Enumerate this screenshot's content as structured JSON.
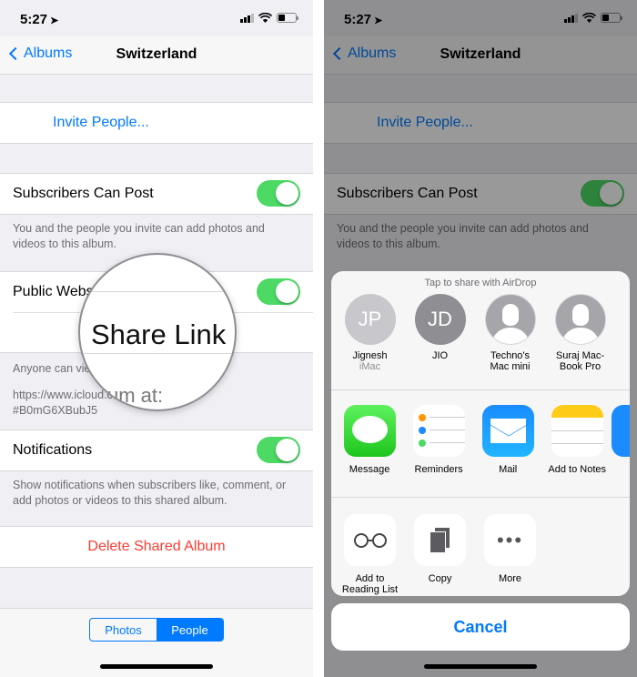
{
  "status": {
    "time": "5:27"
  },
  "nav": {
    "back_label": "Albums",
    "title": "Switzerland"
  },
  "settings": {
    "invite_label": "Invite People...",
    "subscribers_label": "Subscribers Can Post",
    "subscribers_on": true,
    "subscribers_footer": "You and the people you invite can add photos and videos to this album.",
    "public_label": "Public Website",
    "public_label_visible": "Public Webs",
    "public_on": true,
    "share_link_label": "Share Link",
    "public_footer_visible": "Anyone can vie",
    "public_url_line1": "https://www.icloud.c",
    "public_url_line2": "#B0mG6XBubJ5",
    "magnified_fragment": "um at: ",
    "notifications_label": "Notifications",
    "notifications_on": true,
    "notifications_footer": "Show notifications when subscribers like, comment, or add photos or videos to this shared album.",
    "delete_label": "Delete Shared Album"
  },
  "segment": {
    "options": [
      "Photos",
      "People"
    ],
    "selected": "People"
  },
  "share_sheet": {
    "airdrop_title": "Tap to share with AirDrop",
    "airdrop": [
      {
        "initials": "JP",
        "name": "Jignesh",
        "sub": "iMac"
      },
      {
        "initials": "JD",
        "name": "JIO",
        "sub": ""
      },
      {
        "initials": "",
        "name": "Techno's Mac mini",
        "sub": ""
      },
      {
        "initials": "",
        "name": "Suraj Mac-Book Pro",
        "sub": ""
      }
    ],
    "apps": [
      {
        "label": "Message",
        "icon": "messages-icon"
      },
      {
        "label": "Reminders",
        "icon": "reminders-icon"
      },
      {
        "label": "Mail",
        "icon": "mail-icon"
      },
      {
        "label": "Add to Notes",
        "icon": "notes-icon"
      }
    ],
    "actions": [
      {
        "label": "Add to Reading List",
        "icon": "glasses-icon"
      },
      {
        "label": "Copy",
        "icon": "copy-icon"
      },
      {
        "label": "More",
        "icon": "more-icon"
      }
    ],
    "cancel_label": "Cancel"
  },
  "colors": {
    "accent": "#007aff",
    "toggle_on": "#4cd964",
    "danger": "#ff3b30"
  }
}
